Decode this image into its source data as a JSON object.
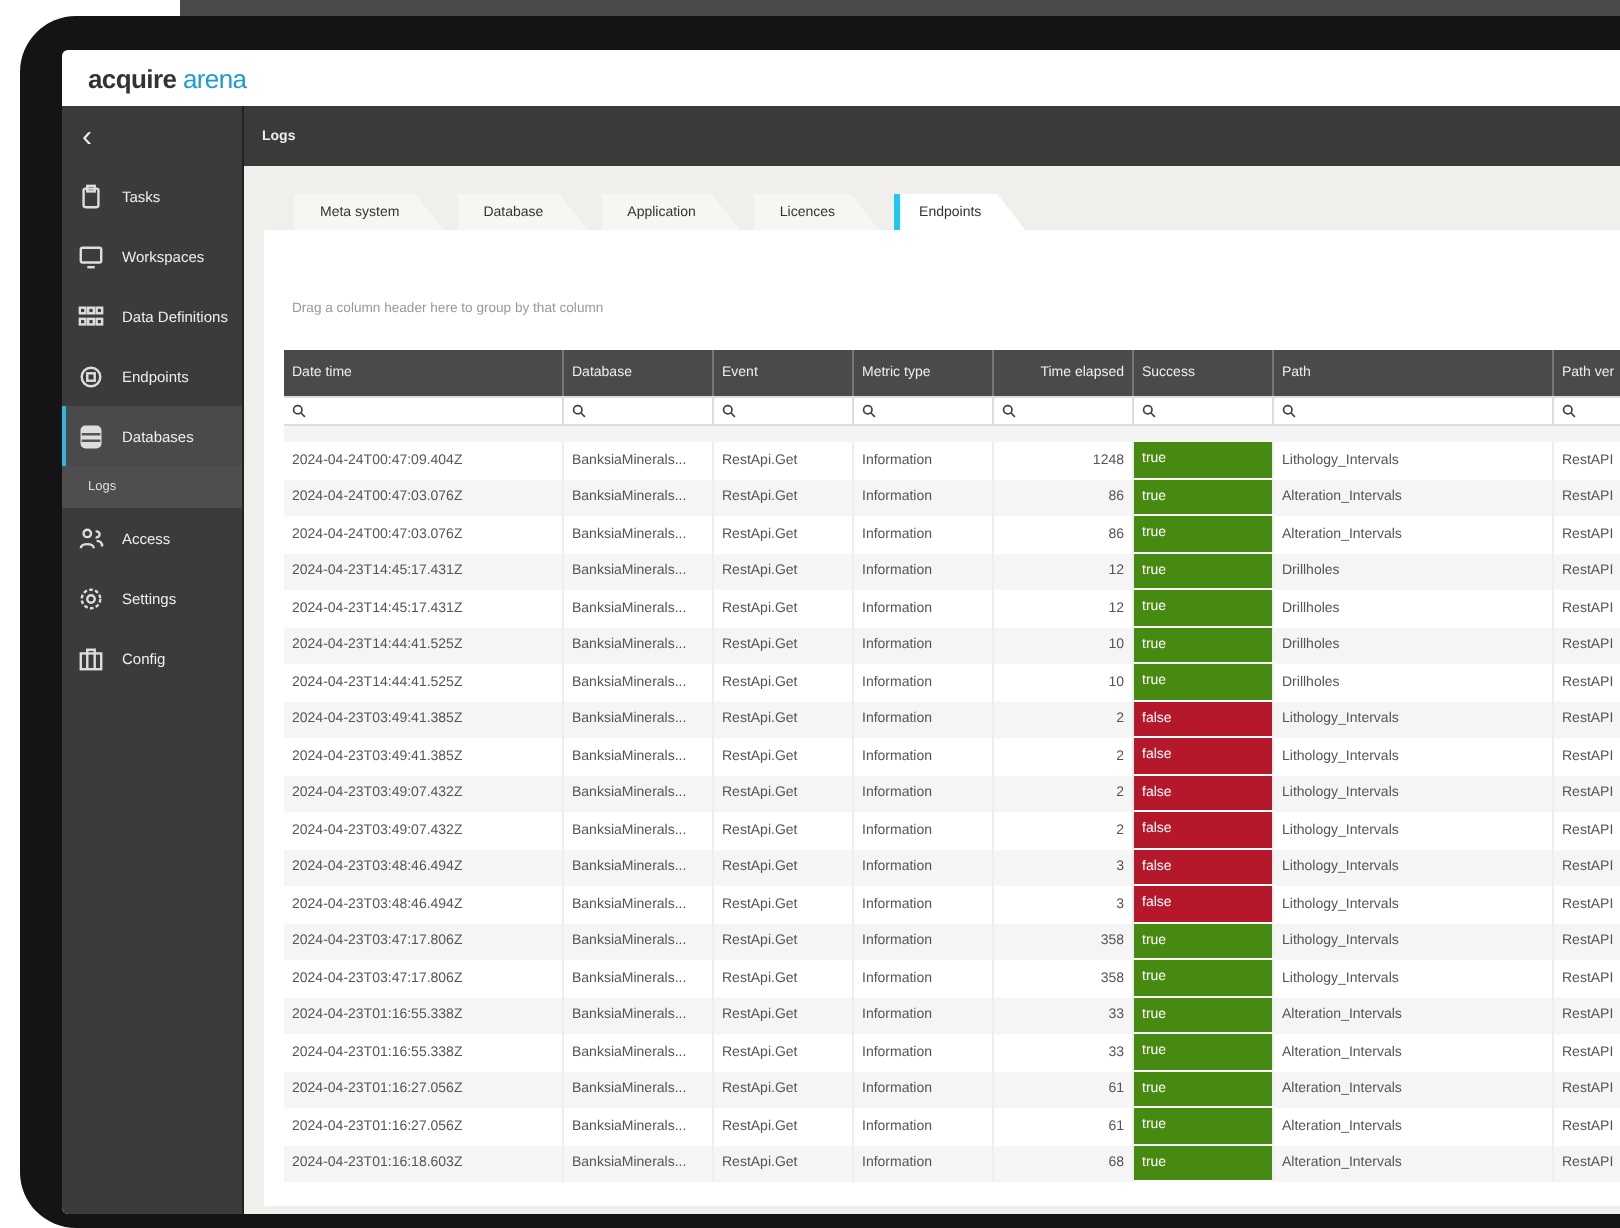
{
  "logo": {
    "first": "acquire",
    "second": "arena"
  },
  "topbar": {
    "back": "‹",
    "title": "Logs"
  },
  "sidebar": {
    "items": [
      {
        "label": "Tasks",
        "kind": "clipboard",
        "selected": false
      },
      {
        "label": "Workspaces",
        "kind": "monitor",
        "selected": false
      },
      {
        "label": "Data Definitions",
        "kind": "grid",
        "selected": false
      },
      {
        "label": "Endpoints",
        "kind": "chip",
        "selected": false
      },
      {
        "label": "Databases",
        "kind": "database",
        "selected": true,
        "children": [
          {
            "label": "Logs"
          }
        ]
      },
      {
        "label": "Access",
        "kind": "people",
        "selected": false
      },
      {
        "label": "Settings",
        "kind": "gear",
        "selected": false
      },
      {
        "label": "Config",
        "kind": "case",
        "selected": false
      }
    ]
  },
  "tabs": [
    {
      "label": "Meta system",
      "selected": false
    },
    {
      "label": "Database",
      "selected": false
    },
    {
      "label": "Application",
      "selected": false
    },
    {
      "label": "Licences",
      "selected": false
    },
    {
      "label": "Endpoints",
      "selected": true
    }
  ],
  "group_hint": "Drag a column header here to group by that column",
  "table": {
    "columns": [
      "Date time",
      "Database",
      "Event",
      "Metric type",
      "Time elapsed",
      "Success",
      "Path",
      "Path ver"
    ],
    "rows": [
      {
        "date": "2024-04-24T00:47:09.404Z",
        "database": "BanksiaMinerals...",
        "event": "RestApi.Get",
        "metric": "Information",
        "elapsed": "1248",
        "success": {
          "text": "true",
          "color": "#468a12"
        },
        "path": "Lithology_Intervals",
        "path_ver": "RestAPI"
      },
      {
        "date": "2024-04-24T00:47:03.076Z",
        "database": "BanksiaMinerals...",
        "event": "RestApi.Get",
        "metric": "Information",
        "elapsed": "86",
        "success": {
          "text": "true",
          "color": "#468a12"
        },
        "path": "Alteration_Intervals",
        "path_ver": "RestAPI"
      },
      {
        "date": "2024-04-24T00:47:03.076Z",
        "database": "BanksiaMinerals...",
        "event": "RestApi.Get",
        "metric": "Information",
        "elapsed": "86",
        "success": {
          "text": "true",
          "color": "#468a12"
        },
        "path": "Alteration_Intervals",
        "path_ver": "RestAPI"
      },
      {
        "date": "2024-04-23T14:45:17.431Z",
        "database": "BanksiaMinerals...",
        "event": "RestApi.Get",
        "metric": "Information",
        "elapsed": "12",
        "success": {
          "text": "true",
          "color": "#468a12"
        },
        "path": "Drillholes",
        "path_ver": "RestAPI"
      },
      {
        "date": "2024-04-23T14:45:17.431Z",
        "database": "BanksiaMinerals...",
        "event": "RestApi.Get",
        "metric": "Information",
        "elapsed": "12",
        "success": {
          "text": "true",
          "color": "#468a12"
        },
        "path": "Drillholes",
        "path_ver": "RestAPI"
      },
      {
        "date": "2024-04-23T14:44:41.525Z",
        "database": "BanksiaMinerals...",
        "event": "RestApi.Get",
        "metric": "Information",
        "elapsed": "10",
        "success": {
          "text": "true",
          "color": "#468a12"
        },
        "path": "Drillholes",
        "path_ver": "RestAPI"
      },
      {
        "date": "2024-04-23T14:44:41.525Z",
        "database": "BanksiaMinerals...",
        "event": "RestApi.Get",
        "metric": "Information",
        "elapsed": "10",
        "success": {
          "text": "true",
          "color": "#468a12"
        },
        "path": "Drillholes",
        "path_ver": "RestAPI"
      },
      {
        "date": "2024-04-23T03:49:41.385Z",
        "database": "BanksiaMinerals...",
        "event": "RestApi.Get",
        "metric": "Information",
        "elapsed": "2",
        "success": {
          "text": "false",
          "color": "#b5172b"
        },
        "path": "Lithology_Intervals",
        "path_ver": "RestAPI"
      },
      {
        "date": "2024-04-23T03:49:41.385Z",
        "database": "BanksiaMinerals...",
        "event": "RestApi.Get",
        "metric": "Information",
        "elapsed": "2",
        "success": {
          "text": "false",
          "color": "#b5172b"
        },
        "path": "Lithology_Intervals",
        "path_ver": "RestAPI"
      },
      {
        "date": "2024-04-23T03:49:07.432Z",
        "database": "BanksiaMinerals...",
        "event": "RestApi.Get",
        "metric": "Information",
        "elapsed": "2",
        "success": {
          "text": "false",
          "color": "#b5172b"
        },
        "path": "Lithology_Intervals",
        "path_ver": "RestAPI"
      },
      {
        "date": "2024-04-23T03:49:07.432Z",
        "database": "BanksiaMinerals...",
        "event": "RestApi.Get",
        "metric": "Information",
        "elapsed": "2",
        "success": {
          "text": "false",
          "color": "#b5172b"
        },
        "path": "Lithology_Intervals",
        "path_ver": "RestAPI"
      },
      {
        "date": "2024-04-23T03:48:46.494Z",
        "database": "BanksiaMinerals...",
        "event": "RestApi.Get",
        "metric": "Information",
        "elapsed": "3",
        "success": {
          "text": "false",
          "color": "#b5172b"
        },
        "path": "Lithology_Intervals",
        "path_ver": "RestAPI"
      },
      {
        "date": "2024-04-23T03:48:46.494Z",
        "database": "BanksiaMinerals...",
        "event": "RestApi.Get",
        "metric": "Information",
        "elapsed": "3",
        "success": {
          "text": "false",
          "color": "#b5172b"
        },
        "path": "Lithology_Intervals",
        "path_ver": "RestAPI"
      },
      {
        "date": "2024-04-23T03:47:17.806Z",
        "database": "BanksiaMinerals...",
        "event": "RestApi.Get",
        "metric": "Information",
        "elapsed": "358",
        "success": {
          "text": "true",
          "color": "#468a12"
        },
        "path": "Lithology_Intervals",
        "path_ver": "RestAPI"
      },
      {
        "date": "2024-04-23T03:47:17.806Z",
        "database": "BanksiaMinerals...",
        "event": "RestApi.Get",
        "metric": "Information",
        "elapsed": "358",
        "success": {
          "text": "true",
          "color": "#468a12"
        },
        "path": "Lithology_Intervals",
        "path_ver": "RestAPI"
      },
      {
        "date": "2024-04-23T01:16:55.338Z",
        "database": "BanksiaMinerals...",
        "event": "RestApi.Get",
        "metric": "Information",
        "elapsed": "33",
        "success": {
          "text": "true",
          "color": "#468a12"
        },
        "path": "Alteration_Intervals",
        "path_ver": "RestAPI"
      },
      {
        "date": "2024-04-23T01:16:55.338Z",
        "database": "BanksiaMinerals...",
        "event": "RestApi.Get",
        "metric": "Information",
        "elapsed": "33",
        "success": {
          "text": "true",
          "color": "#468a12"
        },
        "path": "Alteration_Intervals",
        "path_ver": "RestAPI"
      },
      {
        "date": "2024-04-23T01:16:27.056Z",
        "database": "BanksiaMinerals...",
        "event": "RestApi.Get",
        "metric": "Information",
        "elapsed": "61",
        "success": {
          "text": "true",
          "color": "#468a12"
        },
        "path": "Alteration_Intervals",
        "path_ver": "RestAPI"
      },
      {
        "date": "2024-04-23T01:16:27.056Z",
        "database": "BanksiaMinerals...",
        "event": "RestApi.Get",
        "metric": "Information",
        "elapsed": "61",
        "success": {
          "text": "true",
          "color": "#468a12"
        },
        "path": "Alteration_Intervals",
        "path_ver": "RestAPI"
      },
      {
        "date": "2024-04-23T01:16:18.603Z",
        "database": "BanksiaMinerals...",
        "event": "RestApi.Get",
        "metric": "Information",
        "elapsed": "68",
        "success": {
          "text": "true",
          "color": "#468a12"
        },
        "path": "Alteration_Intervals",
        "path_ver": "RestAPI"
      }
    ]
  }
}
